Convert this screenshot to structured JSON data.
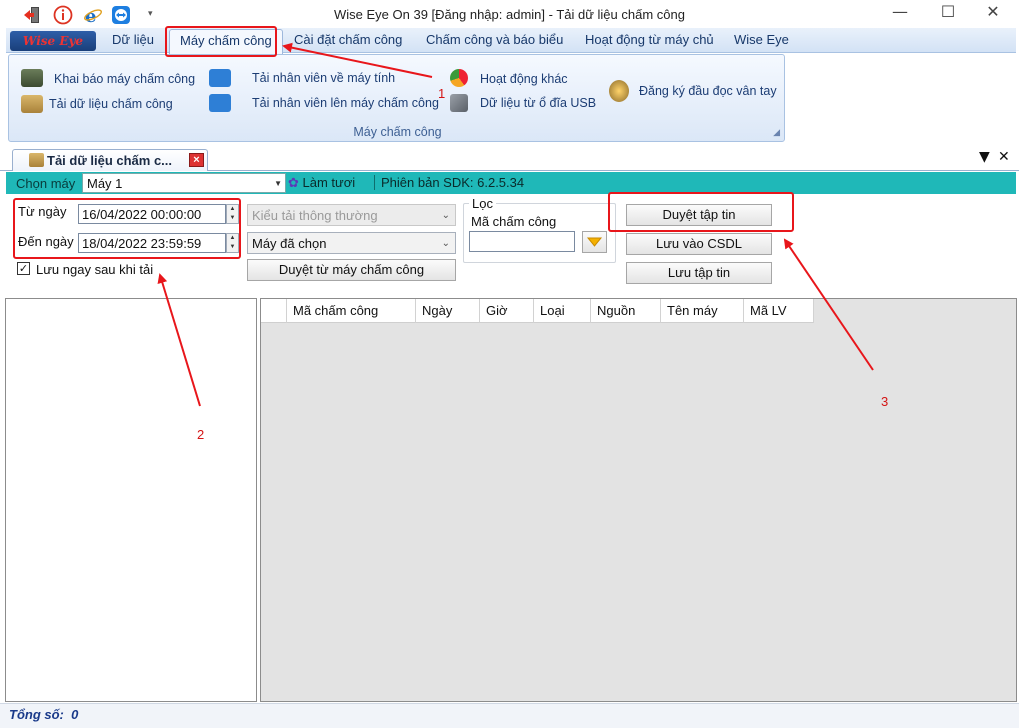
{
  "window": {
    "title": "Wise Eye On 39 [Đăng nhập: admin] - Tải dữ liệu chấm công",
    "minimize": "—",
    "maximize": "☐",
    "close": "✕"
  },
  "quick_access": [
    "exit-icon",
    "info-icon",
    "ie-icon",
    "teamviewer-icon",
    "dropdown-arrow-icon"
  ],
  "ribbon": {
    "logo": "Wise Eye",
    "tabs": [
      {
        "label": "Dữ liệu"
      },
      {
        "label": "Máy chấm công"
      },
      {
        "label": "Cài đặt chấm công"
      },
      {
        "label": "Chấm công và báo biểu"
      },
      {
        "label": "Hoạt động từ máy chủ"
      },
      {
        "label": "Wise Eye"
      }
    ],
    "active_tab": 1,
    "group_label": "Máy chấm công",
    "items": {
      "khai_bao": "Khai báo máy chấm công",
      "tai_du_lieu": "Tải dữ liệu chấm công",
      "tai_nv_ve": "Tải nhân viên về máy tính",
      "tai_nv_len": "Tải nhân viên lên máy chấm công",
      "hoat_dong": "Hoạt động khác",
      "usb": "Dữ liệu từ ổ đĩa USB",
      "van_tay": "Đăng ký đầu đọc vân tay"
    }
  },
  "doc_tab": {
    "label": "Tải dữ liệu chấm c...",
    "close": "×"
  },
  "machine_bar": {
    "label": "Chọn máy",
    "selected": "Máy 1",
    "refresh": "Làm tươi",
    "sdk": "Phiên bản SDK: 6.2.5.34"
  },
  "form": {
    "from_label": "Từ ngày",
    "from_value": "16/04/2022 00:00:00",
    "to_label": "Đến ngày",
    "to_value": "18/04/2022 23:59:59",
    "download_mode": "Kiểu tải thông thường",
    "machine_select": "Máy đã chọn",
    "browse_machine": "Duyệt từ máy chấm công",
    "filter_title": "Lọc",
    "filter_label": "Mã chấm công",
    "filter_value": "",
    "save_after_download": "Lưu ngay sau khi tải",
    "save_after_download_checked": true,
    "browse_file": "Duyệt tập tin",
    "save_db": "Lưu vào CSDL",
    "save_file": "Lưu tập tin"
  },
  "grid": {
    "columns": [
      "Mã chấm công",
      "Ngày",
      "Giờ",
      "Loại",
      "Nguồn",
      "Tên máy",
      "Mã LV"
    ],
    "rows": []
  },
  "status": {
    "total_label": "Tổng số:",
    "total_value": "0"
  },
  "annotations": [
    "1",
    "2",
    "3"
  ],
  "colors": {
    "teal_bar": "#1fb8b8",
    "annotation_red": "#e8161b",
    "ribbon_blue": "#d3e2f5"
  }
}
